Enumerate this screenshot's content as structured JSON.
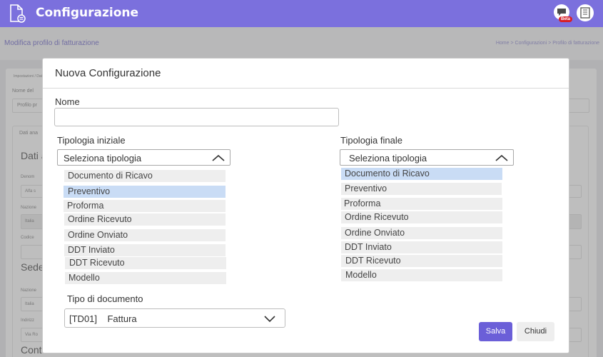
{
  "app": {
    "title": "Configurazione",
    "beta_badge": "Beta"
  },
  "page": {
    "title": "Modifica profilo di fatturazione",
    "breadcrumb": "Home  >  Configurazioni  >  Profilo di fatturazione"
  },
  "background": {
    "crumb": "Impostazioni / Dati",
    "name_label": "Nome del",
    "name_value": "Profilo pr",
    "tab": "Dati ana",
    "section_dati": "Dati a",
    "denomination_label": "Denom",
    "denomination_value": "Alfa s",
    "nation_label": "Nazione",
    "nation_value": "Italia",
    "fiscal_label": "Codice",
    "section_sede": "Sede",
    "nation2_label": "Nazione",
    "nation2_value": "Italia",
    "address_label": "Indirizz",
    "address_value": "Via Ro",
    "section_cont": "Cont"
  },
  "modal": {
    "title": "Nuova Configurazione",
    "name_label": "Nome",
    "name_value": "",
    "initial_type_label": "Tipologia iniziale",
    "initial_type_placeholder": "Seleziona tipologia",
    "final_type_label": "Tipologia finale",
    "final_type_placeholder": "Seleziona tipologia",
    "initial_options": [
      "Documento di Ricavo",
      "Preventivo",
      "Proforma",
      "Ordine Ricevuto",
      "Ordine Onviato",
      "DDT Inviato",
      "DDT Ricevuto",
      "Modello"
    ],
    "initial_selected": "Preventivo",
    "final_options": [
      "Documento di Ricavo",
      "Preventivo",
      "Proforma",
      "Ordine Ricevuto",
      "Ordine Onviato",
      "DDT Inviato",
      "DDT Ricevuto",
      "Modello"
    ],
    "final_selected": "Documento di Ricavo",
    "doc_type_label": "Tipo di documento",
    "doc_type_value": "[TD01]    Fattura",
    "save_label": "Salva",
    "close_label": "Chiudi"
  },
  "icons": {
    "document": "document-icon",
    "chat": "chat-icon",
    "company": "building-icon",
    "chevron_up": "chevron-up-icon",
    "chevron_down": "chevron-down-icon"
  },
  "colors": {
    "brand": "#7b70dd",
    "primary_button": "#6b5fd8",
    "selected_option": "#c9dcf5",
    "badge": "#d71e28"
  }
}
